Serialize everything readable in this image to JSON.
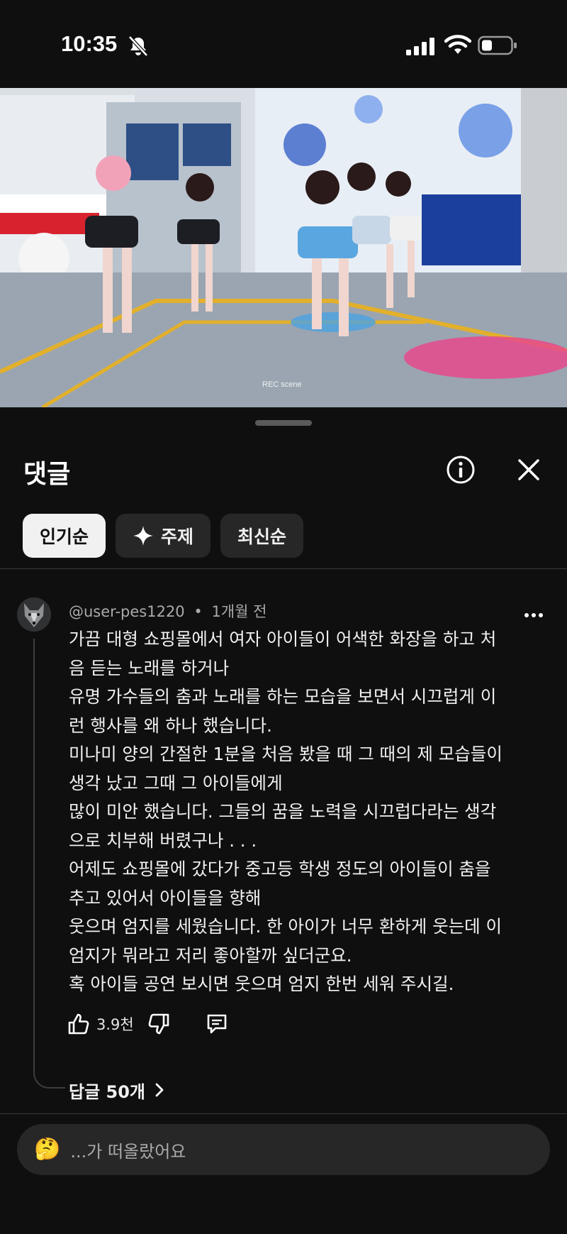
{
  "status_bar": {
    "time": "10:35",
    "icons": [
      "bell-off-icon",
      "signal-icon",
      "wifi-icon",
      "battery-icon"
    ]
  },
  "video": {
    "watermark": "REC scene"
  },
  "comments_panel": {
    "title": "댓글",
    "chips": [
      {
        "label": "인기순",
        "active": true
      },
      {
        "label": "주제",
        "active": false,
        "icon": "sparkle-icon"
      },
      {
        "label": "최신순",
        "active": false
      }
    ],
    "comment": {
      "author": "@user-pes1220",
      "separator": "•",
      "time": "1개월 전",
      "lines": [
        "가끔 대형 쇼핑몰에서 여자 아이들이 어색한 화장을 하고 처",
        "음 듣는 노래를 하거나",
        "유명 가수들의 춤과 노래를 하는 모습을 보면서 시끄럽게 이",
        "런 행사를 왜 하나 했습니다.",
        "미나미 양의 간절한 1분을 처음 봤을 때 그 때의 제 모습들이",
        "생각 났고 그때 그 아이들에게",
        "많이 미안 했습니다. 그들의 꿈을 노력을 시끄럽다라는 생각",
        "으로 치부해 버렸구나 . . .",
        "어제도 쇼핑몰에 갔다가 중고등 학생 정도의 아이들이 춤을",
        "추고 있어서 아이들을 향해",
        "웃으며 엄지를 세웠습니다. 한 아이가 너무 환하게 웃는데 이",
        "엄지가 뭐라고 저리 좋아할까 싶더군요.",
        "혹 아이들 공연 보시면 웃으며 엄지 한번 세워 주시길."
      ],
      "likes": "3.9천",
      "replies_label": "답글 50개"
    },
    "compose": {
      "emoji": "🤔",
      "placeholder": "...가 떠올랐어요"
    }
  }
}
